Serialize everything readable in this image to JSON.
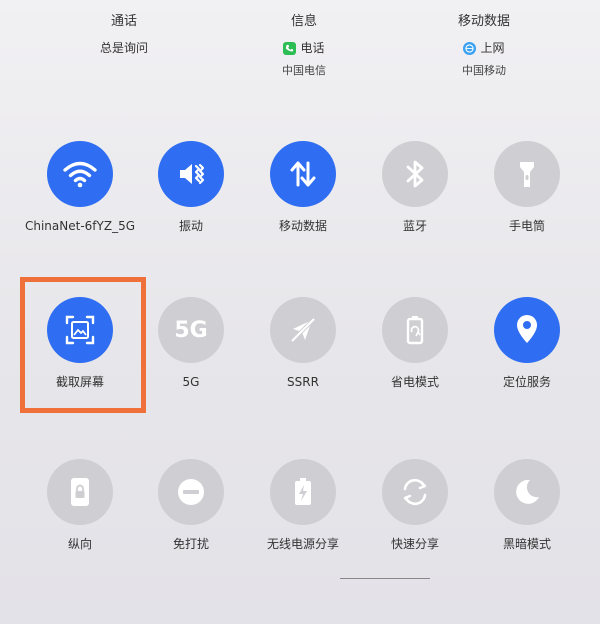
{
  "sim": [
    {
      "title": "通话",
      "line": "总是询问",
      "carrier": ""
    },
    {
      "title": "信息",
      "line": "电话",
      "carrier": "中国电信"
    },
    {
      "title": "移动数据",
      "line": "上网",
      "carrier": "中国移动"
    }
  ],
  "tiles": [
    {
      "label": "ChinaNet-6fYZ_5G",
      "icon": "wifi-icon",
      "on": true
    },
    {
      "label": "振动",
      "icon": "vibrate-icon",
      "on": true
    },
    {
      "label": "移动数据",
      "icon": "mobile-data-icon",
      "on": true
    },
    {
      "label": "蓝牙",
      "icon": "bluetooth-icon",
      "on": false
    },
    {
      "label": "手电筒",
      "icon": "flashlight-icon",
      "on": false
    },
    {
      "label": "截取屏幕",
      "icon": "screenshot-icon",
      "on": true
    },
    {
      "label": "5G",
      "icon": "5g-icon",
      "on": false,
      "icon_text": "5G"
    },
    {
      "label": "SSRR",
      "icon": "airplane-off-icon",
      "on": false
    },
    {
      "label": "省电模式",
      "icon": "battery-saver-icon",
      "on": false
    },
    {
      "label": "定位服务",
      "icon": "location-icon",
      "on": true
    },
    {
      "label": "纵向",
      "icon": "portrait-lock-icon",
      "on": false
    },
    {
      "label": "免打扰",
      "icon": "do-not-disturb-icon",
      "on": false
    },
    {
      "label": "无线电源分享",
      "icon": "wireless-power-share-icon",
      "on": false
    },
    {
      "label": "快速分享",
      "icon": "quick-share-icon",
      "on": false
    },
    {
      "label": "黑暗模式",
      "icon": "dark-mode-icon",
      "on": false
    }
  ],
  "colors": {
    "active": "#2f6ef2",
    "inactive": "#cfcfd3",
    "highlight": "#f0703a"
  }
}
